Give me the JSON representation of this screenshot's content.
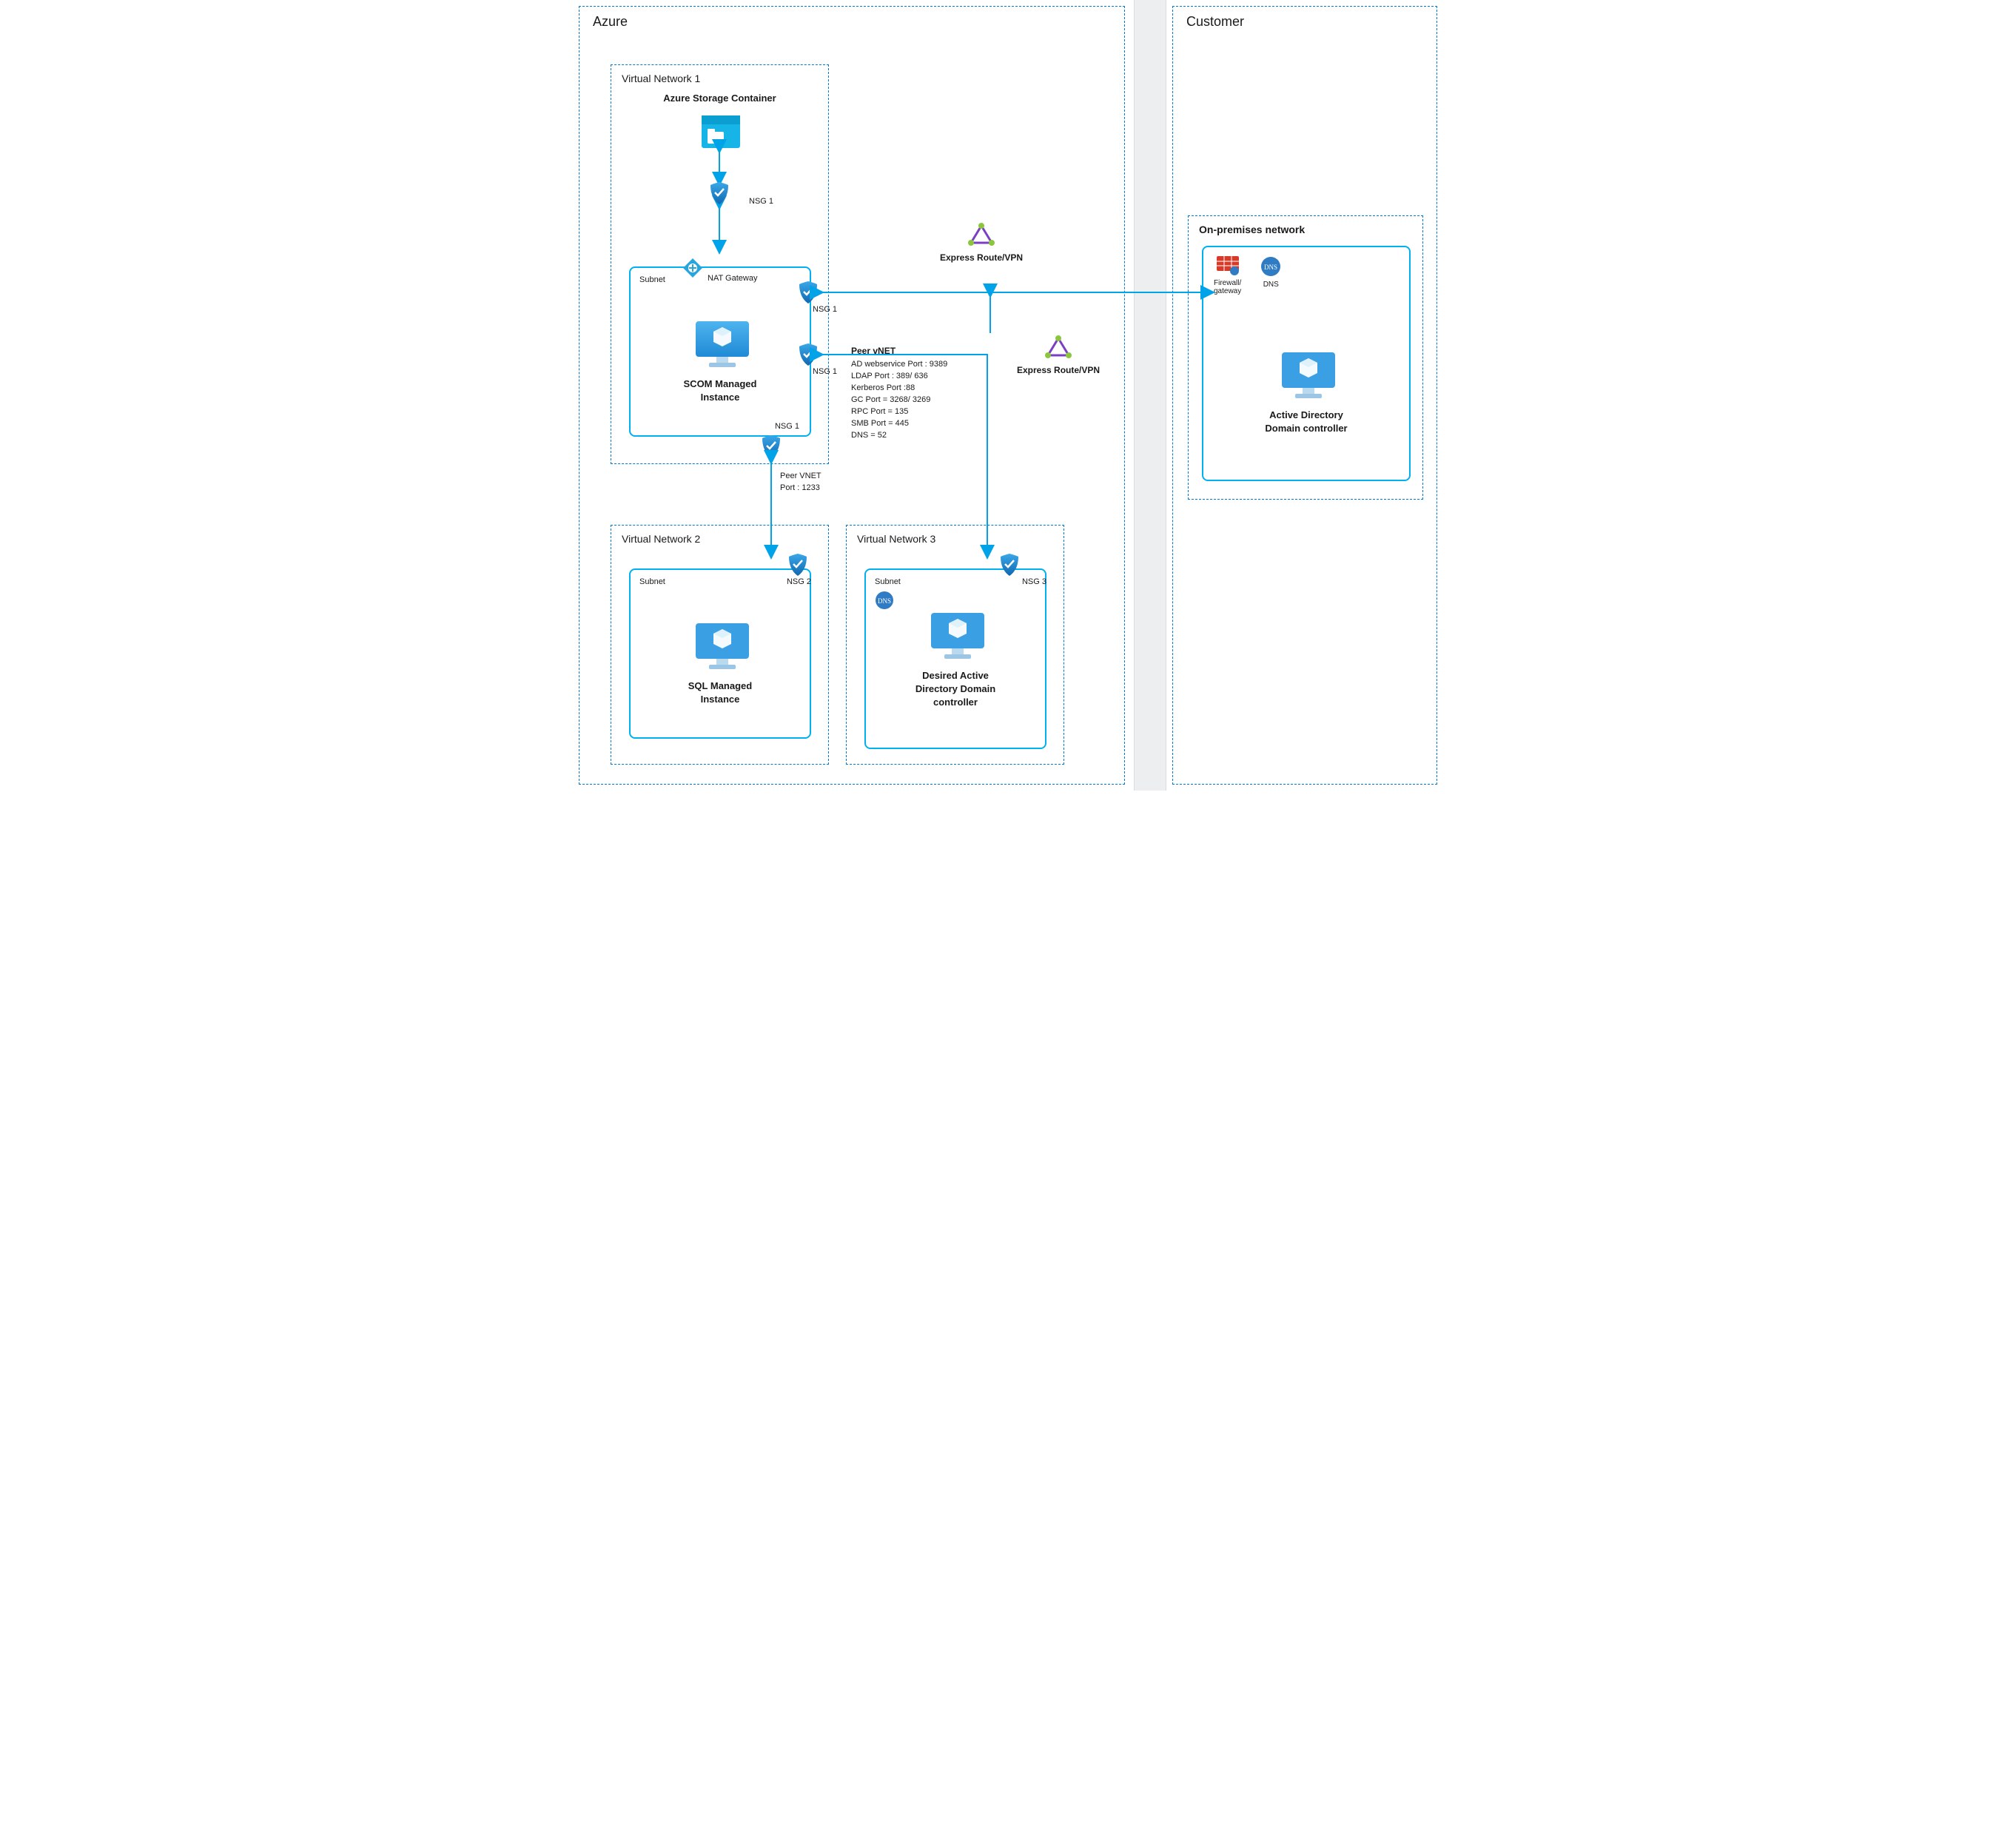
{
  "regions": {
    "azure": "Azure",
    "customer": "Customer"
  },
  "vnets": {
    "v1": "Virtual Network 1",
    "v2": "Virtual Network 2",
    "v3": "Virtual Network 3",
    "onprem": "On-premises network"
  },
  "subnet_label": "Subnet",
  "nodes": {
    "storage_title": "Azure Storage Container",
    "scom": "SCOM Managed\nInstance",
    "sql": "SQL Managed\nInstance",
    "addc": "Desired Active\nDirectory Domain\ncontroller",
    "onprem_addc": "Active Directory\nDomain controller",
    "nat": "NAT Gateway",
    "express": "Express Route/VPN",
    "firewall": "Firewall/\ngateway",
    "dns": "DNS"
  },
  "nsg": {
    "n1": "NSG 1",
    "n2": "NSG 2",
    "n3": "NSG 3"
  },
  "peer_sql": {
    "title": "Peer VNET",
    "line": "Port : 1233"
  },
  "peer_ad": {
    "title": "Peer vNET",
    "lines": [
      "AD webservice Port : 9389",
      "LDAP Port : 389/ 636",
      "Kerberos Port :88",
      "GC Port = 3268/ 3269",
      "RPC Port = 135",
      "SMB Port = 445",
      "DNS = 52"
    ]
  }
}
